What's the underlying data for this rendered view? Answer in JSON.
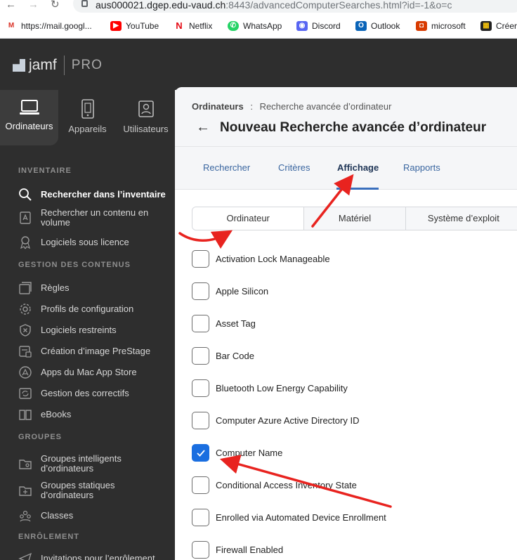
{
  "browser": {
    "url_host": "aus000021.dgep.edu-vaud.ch",
    "url_rest": ":8443/advancedComputerSearches.html?id=-1&o=c",
    "bookmarks": [
      {
        "label": "https://mail.googl...",
        "icon": "gmail-icon",
        "color": "#d93025"
      },
      {
        "label": "YouTube",
        "icon": "youtube-icon",
        "color": "#ff0000"
      },
      {
        "label": "Netflix",
        "icon": "netflix-icon",
        "color": "#e50914"
      },
      {
        "label": "WhatsApp",
        "icon": "whatsapp-icon",
        "color": "#25d366"
      },
      {
        "label": "Discord",
        "icon": "discord-icon",
        "color": "#5865f2"
      },
      {
        "label": "Outlook",
        "icon": "outlook-icon",
        "color": "#0a64b8"
      },
      {
        "label": "microsoft",
        "icon": "office-icon",
        "color": "#d83b01"
      },
      {
        "label": "Créer",
        "icon": "grid-icon",
        "color": "#222222"
      }
    ]
  },
  "app": {
    "logo_text": "jamf",
    "logo_suffix": "PRO"
  },
  "sidebar": {
    "categories": [
      {
        "label": "Ordinateurs",
        "icon": "laptop-icon",
        "active": true
      },
      {
        "label": "Appareils",
        "icon": "devices-icon",
        "active": false
      },
      {
        "label": "Utilisateurs",
        "icon": "users-icon",
        "active": false
      }
    ],
    "section_inventaire": "INVENTAIRE",
    "section_gestion": "GESTION DES CONTENUS",
    "section_groupes": "GROUPES",
    "section_enrolement": "ENRÔLEMENT",
    "items": {
      "search_inventory": "Rechercher dans l’inventaire",
      "search_volume_1": "Rechercher un contenu en",
      "search_volume_2": "volume",
      "licensed_software": "Logiciels sous licence",
      "policies": "Règles",
      "config_profiles": "Profils de configuration",
      "restricted_software": "Logiciels restreints",
      "prestage": "Création d’image PreStage",
      "mac_app_store": "Apps du Mac App Store",
      "patch_management": "Gestion des correctifs",
      "ebooks": "eBooks",
      "smart_groups_1": "Groupes intelligents",
      "smart_groups_2": "d’ordinateurs",
      "static_groups_1": "Groupes statiques",
      "static_groups_2": "d’ordinateurs",
      "classes": "Classes",
      "enrollment_invitations": "Invitations pour l’enrôlement"
    }
  },
  "main": {
    "breadcrumb_parent": "Ordinateurs",
    "breadcrumb_sep": ":",
    "breadcrumb_current": "Recherche avancée d’ordinateur",
    "title": "Nouveau Recherche avancée d’ordinateur",
    "tabs": [
      "Rechercher",
      "Critères",
      "Affichage",
      "Rapports"
    ],
    "active_tab": "Affichage",
    "subtabs": [
      "Ordinateur",
      "Matériel",
      "Système d’exploit"
    ],
    "active_subtab": "Ordinateur",
    "fields": [
      {
        "label": "Activation Lock Manageable",
        "checked": false
      },
      {
        "label": "Apple Silicon",
        "checked": false
      },
      {
        "label": "Asset Tag",
        "checked": false
      },
      {
        "label": "Bar Code",
        "checked": false
      },
      {
        "label": "Bluetooth Low Energy Capability",
        "checked": false
      },
      {
        "label": "Computer Azure Active Directory ID",
        "checked": false
      },
      {
        "label": "Computer Name",
        "checked": true
      },
      {
        "label": "Conditional Access Inventory State",
        "checked": false
      },
      {
        "label": "Enrolled via Automated Device Enrollment",
        "checked": false
      },
      {
        "label": "Firewall Enabled",
        "checked": false
      }
    ]
  },
  "colors": {
    "sidebar_bg": "#2e2e2e",
    "accent_blue": "#1a6ee0",
    "annotation_red": "#e8231f"
  }
}
